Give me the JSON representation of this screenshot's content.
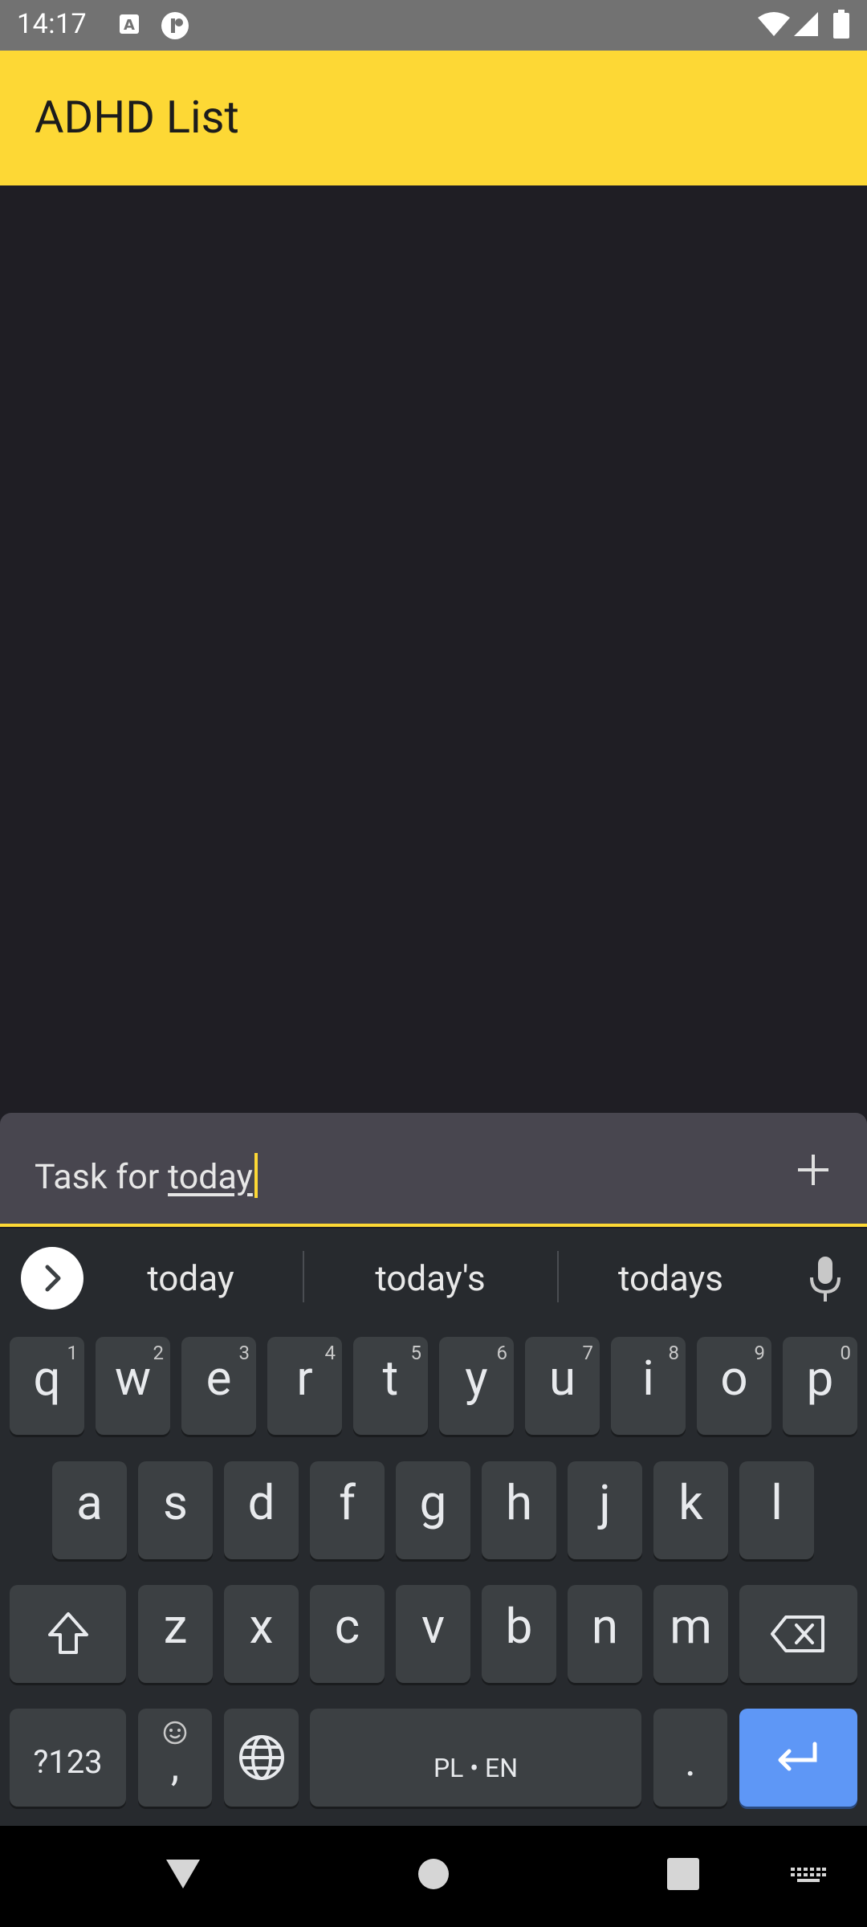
{
  "status_bar": {
    "time": "14:17",
    "left_icons": [
      "font-icon",
      "notification-app-icon"
    ],
    "right_icons": [
      "wifi-icon",
      "signal-icon",
      "battery-icon"
    ]
  },
  "app_bar": {
    "title": "ADHD List",
    "color": "#fdd835"
  },
  "task_input": {
    "prefix_text": "Task for ",
    "underlined_text": "today",
    "add_icon": "plus-icon"
  },
  "keyboard": {
    "suggestions": [
      "today",
      "today's",
      "todays"
    ],
    "rows": [
      [
        {
          "char": "q",
          "hint": "1"
        },
        {
          "char": "w",
          "hint": "2"
        },
        {
          "char": "e",
          "hint": "3"
        },
        {
          "char": "r",
          "hint": "4"
        },
        {
          "char": "t",
          "hint": "5"
        },
        {
          "char": "y",
          "hint": "6"
        },
        {
          "char": "u",
          "hint": "7"
        },
        {
          "char": "i",
          "hint": "8"
        },
        {
          "char": "o",
          "hint": "9"
        },
        {
          "char": "p",
          "hint": "0"
        }
      ],
      [
        "a",
        "s",
        "d",
        "f",
        "g",
        "h",
        "j",
        "k",
        "l"
      ],
      [
        "z",
        "x",
        "c",
        "v",
        "b",
        "n",
        "m"
      ]
    ],
    "symbols_label": "?123",
    "comma_label": ",",
    "space_label": "PL • EN",
    "period_label": ".",
    "accent_color": "#5e97f6"
  },
  "nav_bar": {
    "icons": [
      "back-icon",
      "home-icon",
      "recents-icon",
      "keyboard-switch-icon"
    ]
  }
}
